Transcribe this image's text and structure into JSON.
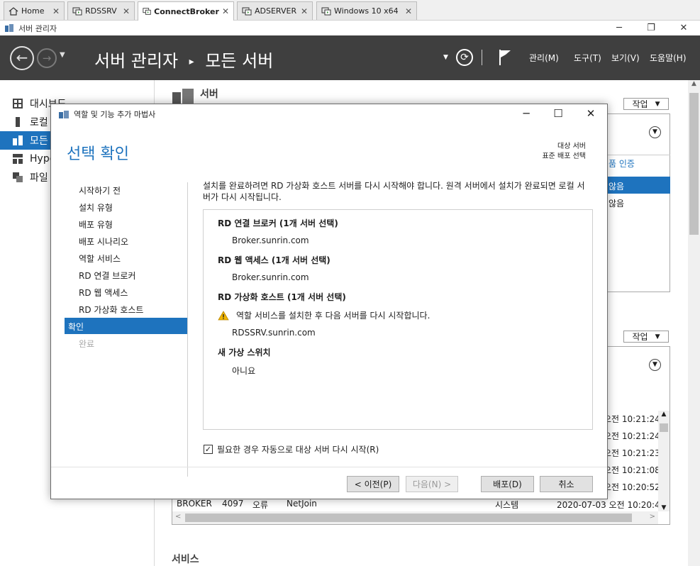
{
  "vm_tabs": [
    {
      "label": "Home"
    },
    {
      "label": "RDSSRV"
    },
    {
      "label": "ConnectBroker"
    },
    {
      "label": "ADSERVER"
    },
    {
      "label": "Windows 10 x64"
    }
  ],
  "app": {
    "window_title": "서버 관리자",
    "breadcrumb_root": "서버 관리자",
    "breadcrumb_sep": "▸",
    "breadcrumb_current": "모든 서버",
    "menu": [
      "관리(M)",
      "도구(T)",
      "보기(V)",
      "도움말(H)"
    ]
  },
  "sidebar": {
    "items": [
      {
        "label": "대시보드"
      },
      {
        "label": "로컬"
      },
      {
        "label": "모든"
      },
      {
        "label": "Hype"
      },
      {
        "label": "파일"
      }
    ]
  },
  "main": {
    "section_title": "서버",
    "tasks_label": "작업",
    "auth_header": "품 인증",
    "auth_rows": [
      "않음",
      "않음"
    ],
    "event_times": [
      "2020-07-03 오전 10:28:02",
      "오전 10:21:24",
      "오전 10:21:23",
      "오전 10:21:08",
      "오전 10:20:52",
      "2020-07-03 오전 10:20:47"
    ],
    "event_last_row": {
      "server": "BROKER",
      "id": "4097",
      "severity": "오류",
      "source": "NetJoin",
      "log": "시스템",
      "datetime": "2020-07-03 오전 10:20:47"
    },
    "services_label": "서비스"
  },
  "wizard": {
    "window_title": "역할 및 기능 추가 마법사",
    "heading": "선택 확인",
    "target_label": "대상 서버",
    "target_value": "표준 배포 선택",
    "nav": [
      {
        "label": "시작하기 전",
        "state": "normal"
      },
      {
        "label": "설치 유형",
        "state": "normal"
      },
      {
        "label": "배포 유형",
        "state": "normal"
      },
      {
        "label": "배포 시나리오",
        "state": "normal"
      },
      {
        "label": "역할 서비스",
        "state": "normal"
      },
      {
        "label": "RD 연결 브로커",
        "state": "normal"
      },
      {
        "label": "RD 웹 액세스",
        "state": "normal"
      },
      {
        "label": "RD 가상화 호스트",
        "state": "normal"
      },
      {
        "label": "확인",
        "state": "selected"
      },
      {
        "label": "완료",
        "state": "disabled"
      }
    ],
    "description": "설치를 완료하려면 RD 가상화 호스트 서버를 다시 시작해야 합니다. 원격 서버에서 설치가 완료되면 로컬 서버가 다시 시작됩니다.",
    "sections": {
      "broker_title": "RD 연결 브로커  (1개 서버 선택)",
      "broker_server": "Broker.sunrin.com",
      "web_title": "RD 웹 액세스  (1개 서버 선택)",
      "web_server": "Broker.sunrin.com",
      "vh_title": "RD 가상화 호스트  (1개 서버 선택)",
      "vh_warning": "역할 서비스를 설치한 후 다음 서버를 다시 시작합니다.",
      "vh_server": "RDSSRV.sunrin.com",
      "switch_title": "새 가상 스위치",
      "switch_value": "아니요"
    },
    "restart_checkbox_label": "필요한 경우 자동으로 대상 서버 다시 시작(R)",
    "restart_checked": true,
    "buttons": {
      "prev": "< 이전(P)",
      "next": "다음(N) >",
      "deploy": "배포(D)",
      "cancel": "취소"
    }
  },
  "colors": {
    "accent": "#1e73be",
    "header_bg": "#3f3f3f",
    "warning": "#f2b600"
  }
}
